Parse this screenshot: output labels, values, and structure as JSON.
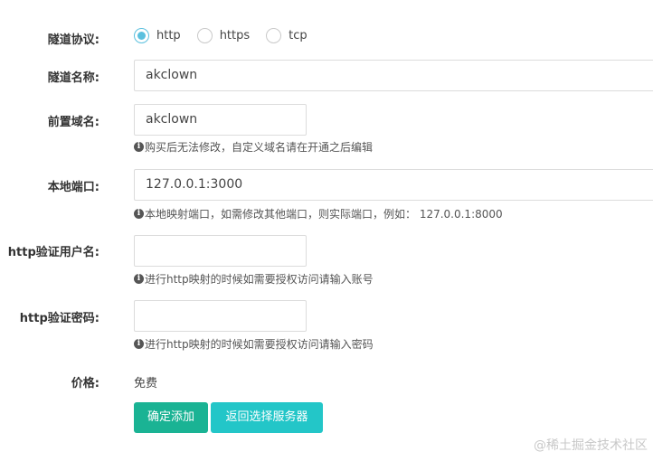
{
  "form": {
    "protocol": {
      "label": "隧道协议:",
      "options": [
        {
          "label": "http",
          "checked": true
        },
        {
          "label": "https",
          "checked": false
        },
        {
          "label": "tcp",
          "checked": false
        }
      ]
    },
    "tunnel_name": {
      "label": "隧道名称:",
      "value": "akclown"
    },
    "prefix_domain": {
      "label": "前置域名:",
      "value": "akclown",
      "help": "购买后无法修改，自定义域名请在开通之后编辑"
    },
    "local_port": {
      "label": "本地端口:",
      "value": "127.0.0.1:3000",
      "help": "本地映射端口，如需修改其他端口，则实际端口，例如： 127.0.0.1:8000"
    },
    "http_user": {
      "label": "http验证用户名:",
      "value": "",
      "help": "进行http映射的时候如需要授权访问请输入账号"
    },
    "http_password": {
      "label": "http验证密码:",
      "value": "",
      "help": "进行http映射的时候如需要授权访问请输入密码"
    },
    "price": {
      "label": "价格:",
      "value": "免费"
    }
  },
  "buttons": {
    "confirm_label": "确定添加",
    "back_label": "返回选择服务器"
  },
  "watermark": "@稀土掘金技术社区",
  "colors": {
    "radio_accent": "#5bc0de",
    "primary_button": "#1ab394",
    "info_button": "#23c6c8"
  },
  "icons": {
    "help": "info-circle-icon"
  }
}
